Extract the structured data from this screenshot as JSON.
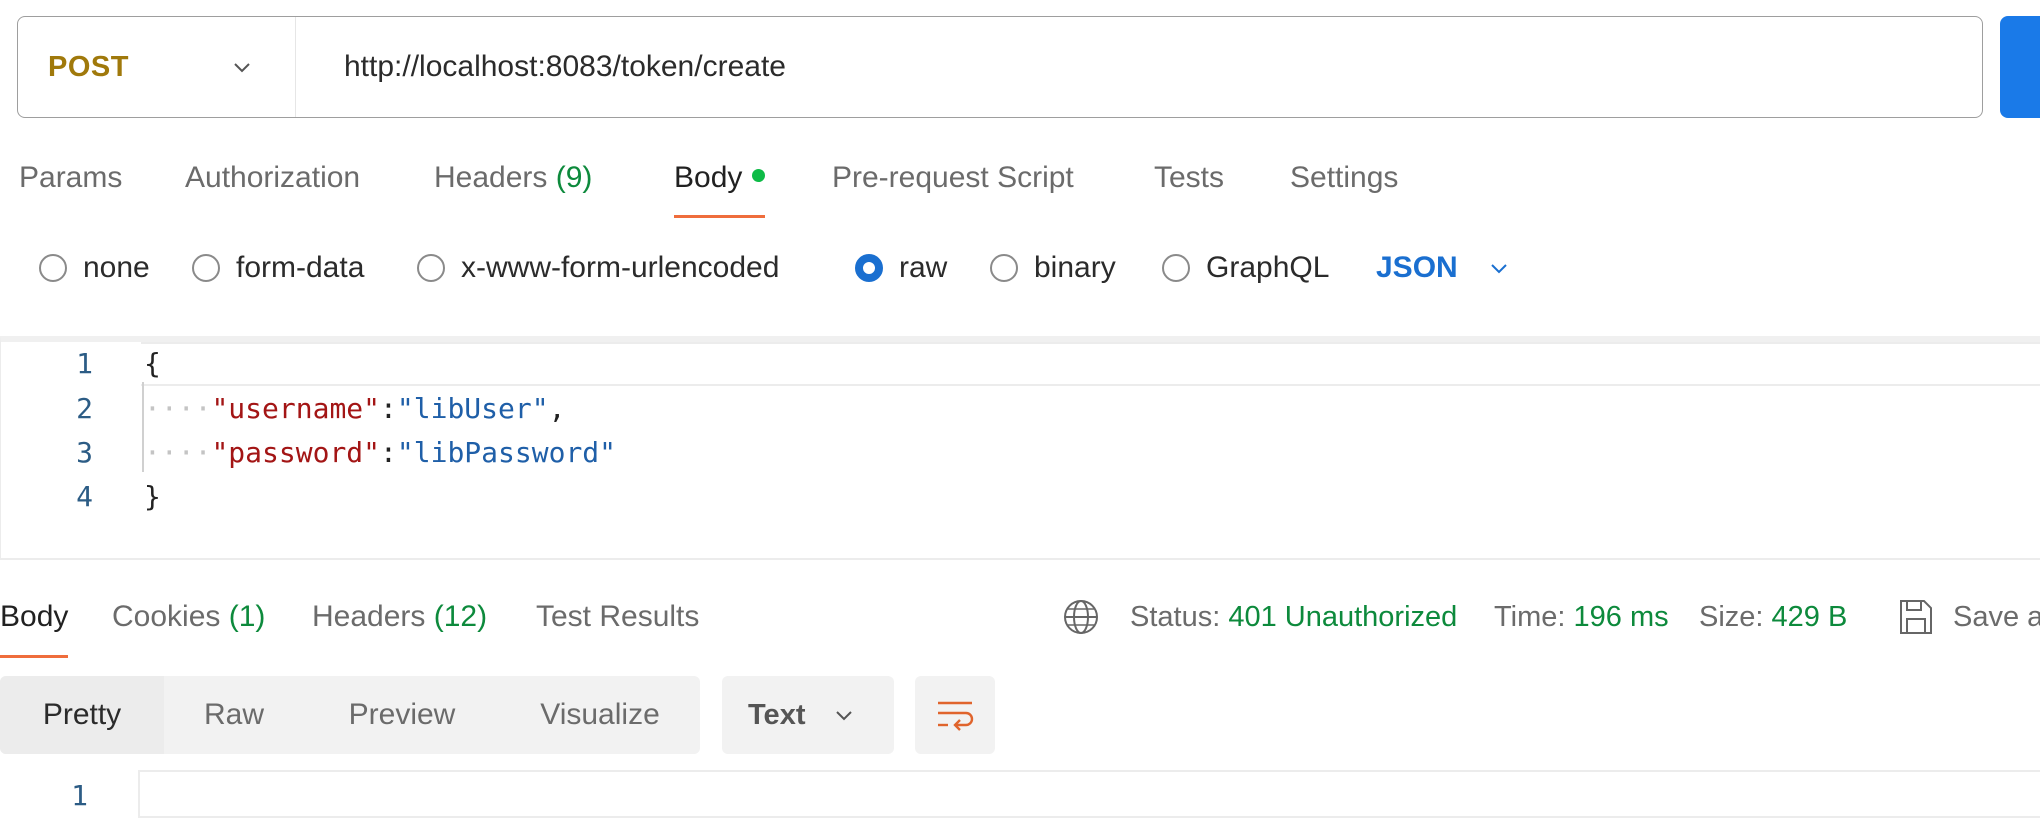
{
  "request": {
    "method": "POST",
    "url": "http://localhost:8083/token/create"
  },
  "request_tabs": [
    {
      "label": "Params"
    },
    {
      "label": "Authorization"
    },
    {
      "label": "Headers",
      "count": "(9)"
    },
    {
      "label": "Body"
    },
    {
      "label": "Pre-request Script"
    },
    {
      "label": "Tests"
    },
    {
      "label": "Settings"
    }
  ],
  "body_types": [
    {
      "label": "none",
      "checked": false
    },
    {
      "label": "form-data",
      "checked": false
    },
    {
      "label": "x-www-form-urlencoded",
      "checked": false
    },
    {
      "label": "raw",
      "checked": true
    },
    {
      "label": "binary",
      "checked": false
    },
    {
      "label": "GraphQL",
      "checked": false
    }
  ],
  "raw_format": "JSON",
  "editor": {
    "lines": [
      {
        "num": "1"
      },
      {
        "num": "2",
        "key": "\"username\"",
        "sep": ":",
        "value": "\"libUser\"",
        "end": ","
      },
      {
        "num": "3",
        "key": "\"password\"",
        "sep": ":",
        "value": "\"libPassword\"",
        "end": ""
      },
      {
        "num": "4"
      }
    ],
    "open_brace": "{",
    "close_brace": "}",
    "whitespace_dots": "····"
  },
  "response_tabs": [
    {
      "label": "Body"
    },
    {
      "label": "Cookies",
      "count": "(1)"
    },
    {
      "label": "Headers",
      "count": "(12)"
    },
    {
      "label": "Test Results"
    }
  ],
  "response_meta": {
    "status_label": "Status:",
    "status_value": "401 Unauthorized",
    "time_label": "Time:",
    "time_value": "196 ms",
    "size_label": "Size:",
    "size_value": "429 B",
    "save_label": "Save a"
  },
  "view_modes": [
    "Pretty",
    "Raw",
    "Preview",
    "Visualize"
  ],
  "response_format": "Text",
  "response_lines": [
    {
      "num": "1"
    }
  ],
  "colors": {
    "method": "#a0790b",
    "accent_tab": "#ef6d3c",
    "count_green": "#0d8a3c",
    "radio_blue": "#1a6fd0",
    "send_blue": "#1a7ae8",
    "body_dot": "#0ebb47"
  },
  "icons": [
    "chevron-down-icon",
    "globe-icon",
    "save-icon",
    "wrap-lines-icon"
  ]
}
